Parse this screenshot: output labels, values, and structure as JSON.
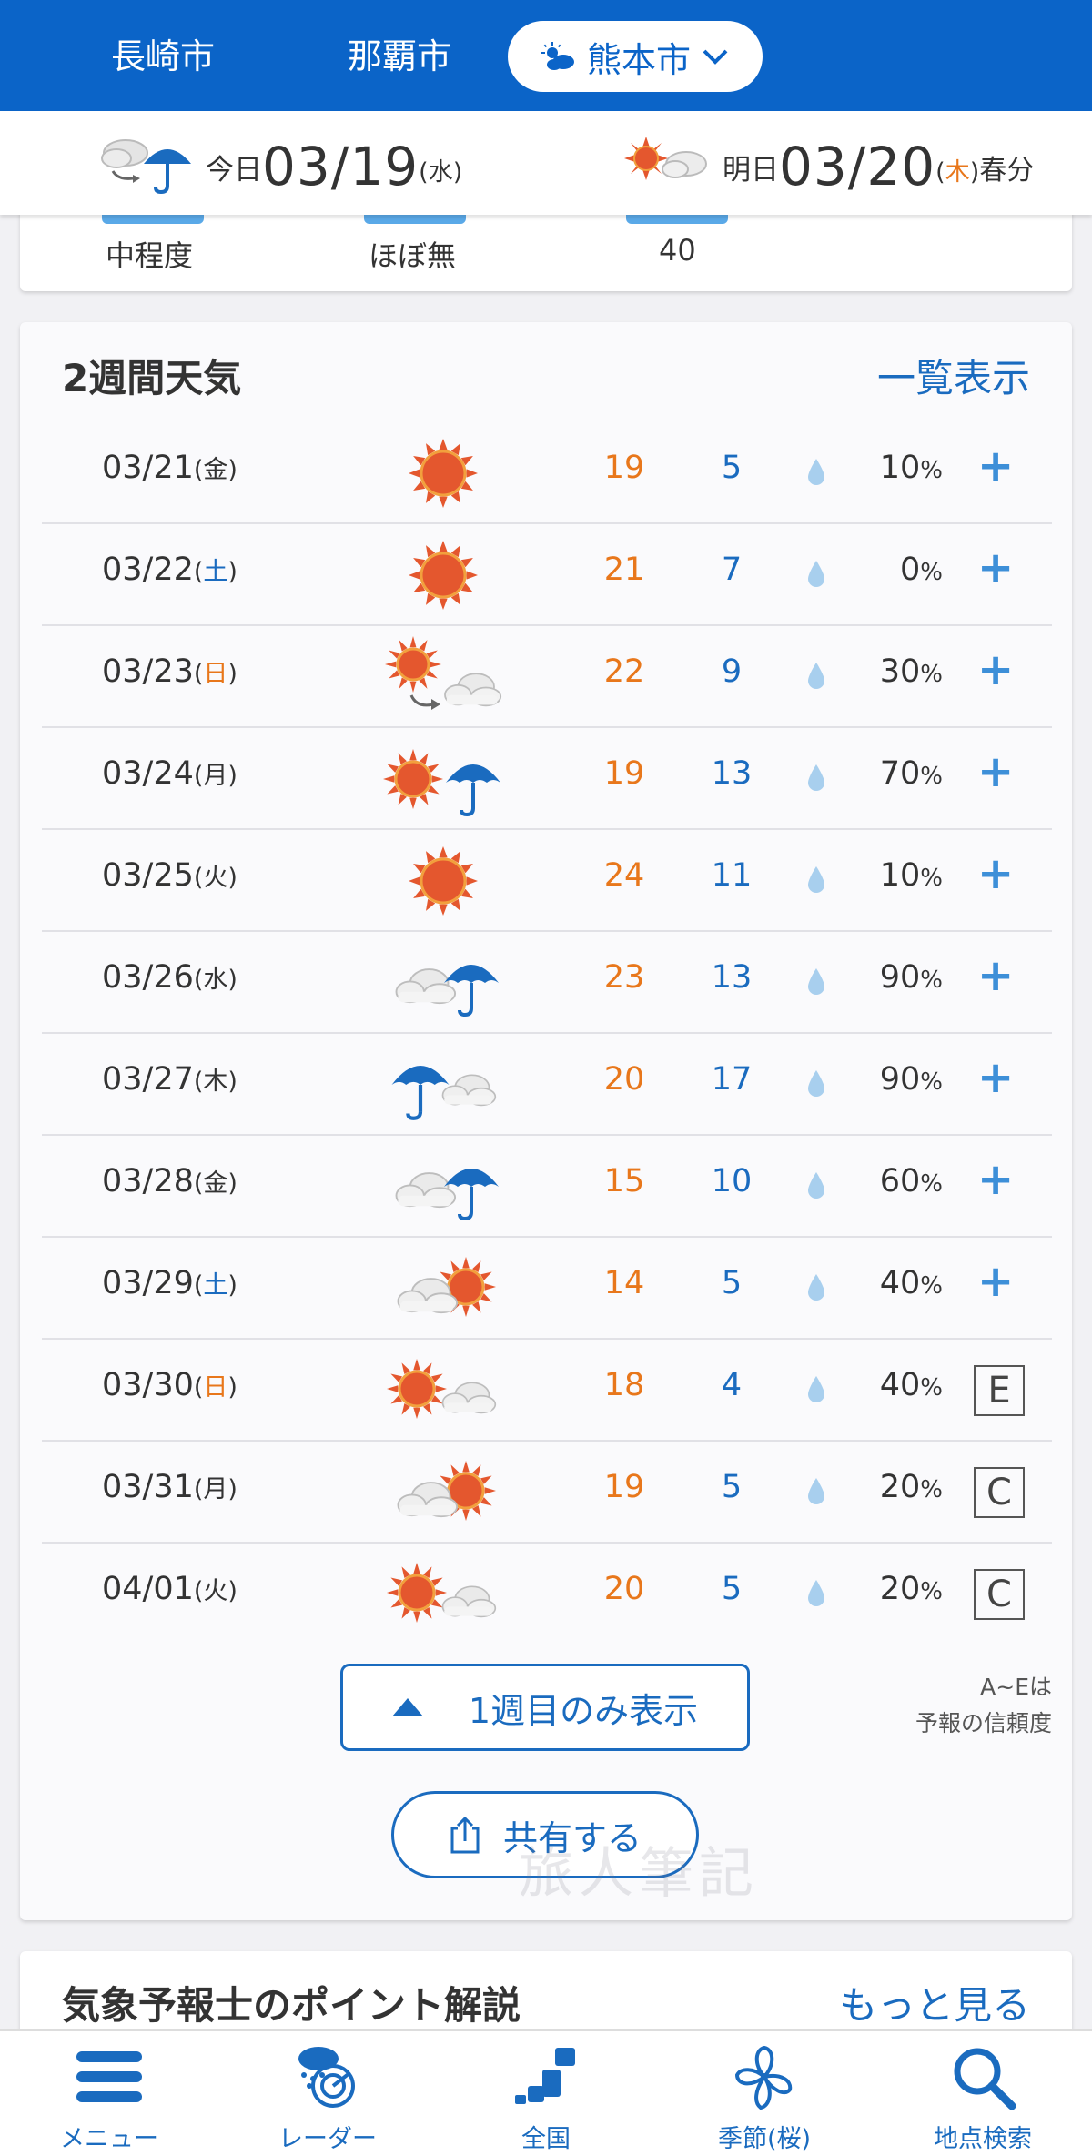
{
  "cities": [
    {
      "name": "長崎市",
      "active": false
    },
    {
      "name": "那覇市",
      "active": false
    },
    {
      "name": "熊本市",
      "active": true
    }
  ],
  "header": {
    "today": {
      "label": "今日",
      "date": "03/19",
      "weekday": "水",
      "icons": [
        "cloud-icon",
        "umbrella-icon"
      ]
    },
    "tomorrow": {
      "label": "明日",
      "date": "03/20",
      "weekday": "木",
      "note": "春分",
      "icons": [
        "sun-icon",
        "cloud-icon"
      ]
    }
  },
  "top_card": {
    "values": [
      "中程度",
      "ほぼ無",
      "40"
    ]
  },
  "two_week": {
    "title": "2週間天気",
    "link": "一覧表示",
    "rows": [
      {
        "date": "03/21",
        "wd": "金",
        "day": "weekday",
        "icon": "sunny",
        "hi": "19",
        "lo": "5",
        "pct": "10",
        "extra": "+"
      },
      {
        "date": "03/22",
        "wd": "土",
        "day": "sat",
        "icon": "sunny",
        "hi": "21",
        "lo": "7",
        "pct": "0",
        "extra": "+"
      },
      {
        "date": "03/23",
        "wd": "日",
        "day": "sun",
        "icon": "sun-then-cloud",
        "hi": "22",
        "lo": "9",
        "pct": "30",
        "extra": "+"
      },
      {
        "date": "03/24",
        "wd": "月",
        "day": "weekday",
        "icon": "sun-rain",
        "hi": "19",
        "lo": "13",
        "pct": "70",
        "extra": "+"
      },
      {
        "date": "03/25",
        "wd": "火",
        "day": "weekday",
        "icon": "sunny",
        "hi": "24",
        "lo": "11",
        "pct": "10",
        "extra": "+"
      },
      {
        "date": "03/26",
        "wd": "水",
        "day": "weekday",
        "icon": "cloud-rain",
        "hi": "23",
        "lo": "13",
        "pct": "90",
        "extra": "+"
      },
      {
        "date": "03/27",
        "wd": "木",
        "day": "weekday",
        "icon": "rain-cloud",
        "hi": "20",
        "lo": "17",
        "pct": "90",
        "extra": "+"
      },
      {
        "date": "03/28",
        "wd": "金",
        "day": "weekday",
        "icon": "cloud-rain",
        "hi": "15",
        "lo": "10",
        "pct": "60",
        "extra": "+"
      },
      {
        "date": "03/29",
        "wd": "土",
        "day": "sat",
        "icon": "cloud-sun",
        "hi": "14",
        "lo": "5",
        "pct": "40",
        "extra": "+"
      },
      {
        "date": "03/30",
        "wd": "日",
        "day": "sun",
        "icon": "sun-cloud",
        "hi": "18",
        "lo": "4",
        "pct": "40",
        "extra": "E"
      },
      {
        "date": "03/31",
        "wd": "月",
        "day": "weekday",
        "icon": "cloud-sun",
        "hi": "19",
        "lo": "5",
        "pct": "20",
        "extra": "C"
      },
      {
        "date": "04/01",
        "wd": "火",
        "day": "weekday",
        "icon": "sun-cloud",
        "hi": "20",
        "lo": "5",
        "pct": "20",
        "extra": "C"
      }
    ],
    "week_button": "1週目のみ表示",
    "note_line1": "A~Eは",
    "note_line2": "予報の信頼度",
    "share_button": "共有する"
  },
  "point_card": {
    "title": "気象予報士のポイント解説",
    "link": "もっと見る"
  },
  "nav": [
    {
      "label": "メニュー",
      "icon": "menu-icon"
    },
    {
      "label": "レーダー",
      "icon": "radar-icon"
    },
    {
      "label": "全国",
      "icon": "japan-map-icon"
    },
    {
      "label": "季節(桜)",
      "icon": "sakura-icon"
    },
    {
      "label": "地点検索",
      "icon": "search-icon"
    }
  ],
  "colors": {
    "brand": "#0b64c8",
    "high": "#e8771b",
    "low": "#1a6bbf",
    "link": "#1a6bbf"
  }
}
